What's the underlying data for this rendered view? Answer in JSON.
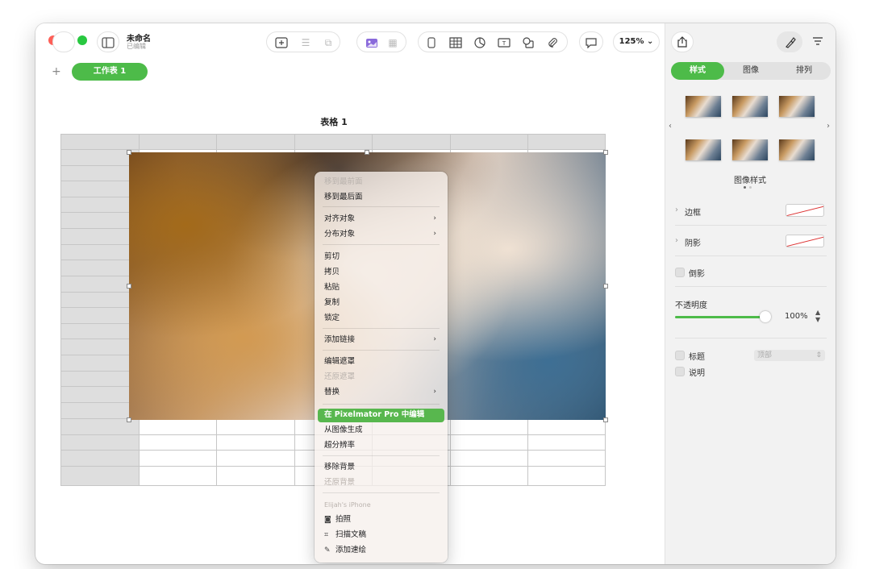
{
  "window": {
    "title": "未命名",
    "subtitle": "已编辑",
    "zoom": "125% ⌄"
  },
  "sheet": {
    "add": "+",
    "tab_label": "工作表 1"
  },
  "table": {
    "title": "表格 1"
  },
  "context_menu": {
    "items": [
      {
        "label": "移到最前面",
        "enabled": false
      },
      {
        "label": "移到最后面",
        "enabled": true
      },
      {
        "label": "对齐对象",
        "enabled": true,
        "submenu": true
      },
      {
        "label": "分布对象",
        "enabled": true,
        "submenu": true
      },
      {
        "label": "剪切",
        "enabled": true
      },
      {
        "label": "拷贝",
        "enabled": true
      },
      {
        "label": "粘贴",
        "enabled": true
      },
      {
        "label": "复制",
        "enabled": true
      },
      {
        "label": "锁定",
        "enabled": true
      },
      {
        "label": "添加链接",
        "enabled": true,
        "submenu": true
      },
      {
        "label": "编辑遮罩",
        "enabled": true
      },
      {
        "label": "还原遮罩",
        "enabled": false
      },
      {
        "label": "替换",
        "enabled": true,
        "submenu": true
      },
      {
        "label": "在 Pixelmator Pro 中编辑",
        "enabled": true,
        "highlighted": true
      },
      {
        "label": "从图像生成",
        "enabled": true
      },
      {
        "label": "超分辨率",
        "enabled": true
      },
      {
        "label": "移除背景",
        "enabled": true
      },
      {
        "label": "还原背景",
        "enabled": false
      },
      {
        "label": "Elijah's iPhone",
        "enabled": false,
        "header": true
      },
      {
        "label": "拍照",
        "enabled": true,
        "icon": "camera-icon"
      },
      {
        "label": "扫描文稿",
        "enabled": true,
        "icon": "scan-icon"
      },
      {
        "label": "添加速绘",
        "enabled": true,
        "icon": "sketch-icon"
      }
    ],
    "chevron": "›",
    "highlight_color": "#58b74e"
  },
  "sidebar": {
    "tabs": [
      "样式",
      "图像",
      "排列"
    ],
    "selected_tab": "样式",
    "nav_prev": "‹",
    "nav_next": "›",
    "style_caption": "图像样式",
    "border_label": "边框",
    "shadow_label": "阴影",
    "reflection_label": "倒影",
    "opacity_label": "不透明度",
    "opacity_value": "100%",
    "opacity_level": 1.0,
    "caption_title_label": "标题",
    "caption_position": "顶部",
    "description_label": "说明",
    "disclosure": "›"
  },
  "colors": {
    "accent": "#4dbb49",
    "close": "#fe5f57",
    "minimize": "#febc2e",
    "zoom": "#28c840"
  }
}
